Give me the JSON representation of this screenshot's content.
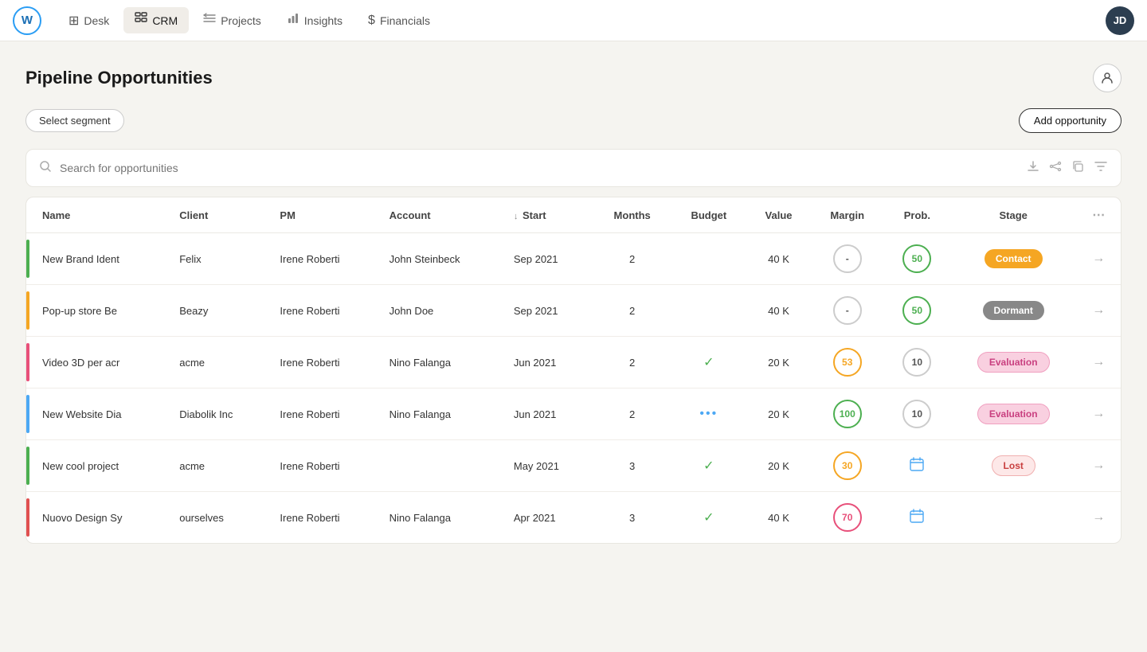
{
  "app": {
    "logo_initials": "W",
    "user_initials": "JD"
  },
  "nav": {
    "items": [
      {
        "id": "desk",
        "label": "Desk",
        "icon": "▦"
      },
      {
        "id": "crm",
        "label": "CRM",
        "icon": "▤",
        "active": true
      },
      {
        "id": "projects",
        "label": "Projects",
        "icon": "◫"
      },
      {
        "id": "insights",
        "label": "Insights",
        "icon": "▮"
      },
      {
        "id": "financials",
        "label": "Financials",
        "icon": "$"
      }
    ]
  },
  "page": {
    "title": "Pipeline Opportunities",
    "select_segment_label": "Select segment",
    "add_opportunity_label": "Add opportunity",
    "search_placeholder": "Search for opportunities"
  },
  "table": {
    "columns": [
      {
        "id": "name",
        "label": "Name"
      },
      {
        "id": "client",
        "label": "Client"
      },
      {
        "id": "pm",
        "label": "PM"
      },
      {
        "id": "account",
        "label": "Account"
      },
      {
        "id": "start",
        "label": "Start",
        "sortable": true
      },
      {
        "id": "months",
        "label": "Months"
      },
      {
        "id": "budget",
        "label": "Budget"
      },
      {
        "id": "value",
        "label": "Value"
      },
      {
        "id": "margin",
        "label": "Margin"
      },
      {
        "id": "prob",
        "label": "Prob."
      },
      {
        "id": "stage",
        "label": "Stage"
      }
    ],
    "rows": [
      {
        "id": 1,
        "indicator_color": "green",
        "name": "New Brand Ident",
        "client": "Felix",
        "pm": "Irene Roberti",
        "account": "John Steinbeck",
        "start": "Sep 2021",
        "months": "2",
        "budget": "",
        "budget_icon": "",
        "value": "40  K",
        "margin": "-",
        "margin_type": "plain",
        "prob": "50",
        "prob_type": "green",
        "stage": "Contact",
        "stage_type": "contact"
      },
      {
        "id": 2,
        "indicator_color": "orange",
        "name": "Pop-up store Be",
        "client": "Beazy",
        "pm": "Irene Roberti",
        "account": "John Doe",
        "start": "Sep 2021",
        "months": "2",
        "budget": "",
        "budget_icon": "",
        "value": "40  K",
        "margin": "-",
        "margin_type": "plain",
        "prob": "50",
        "prob_type": "green",
        "stage": "Dormant",
        "stage_type": "dormant"
      },
      {
        "id": 3,
        "indicator_color": "pink",
        "name": "Video 3D per acr",
        "client": "acme",
        "pm": "Irene Roberti",
        "account": "Nino Falanga",
        "start": "Jun 2021",
        "months": "2",
        "budget": "check",
        "budget_icon": "check",
        "value": "20  K",
        "margin": "53",
        "margin_type": "orange",
        "prob": "10",
        "prob_type": "plain",
        "stage": "Evaluation",
        "stage_type": "evaluation"
      },
      {
        "id": 4,
        "indicator_color": "blue",
        "name": "New Website Dia",
        "client": "Diabolik Inc",
        "pm": "Irene Roberti",
        "account": "Nino Falanga",
        "start": "Jun 2021",
        "months": "2",
        "budget": "dots",
        "budget_icon": "dots",
        "value": "20  K",
        "margin": "100",
        "margin_type": "full",
        "prob": "10",
        "prob_type": "plain",
        "stage": "Evaluation",
        "stage_type": "evaluation"
      },
      {
        "id": 5,
        "indicator_color": "green",
        "name": "New cool project",
        "client": "acme",
        "pm": "Irene Roberti",
        "account": "",
        "start": "May 2021",
        "months": "3",
        "budget": "check",
        "budget_icon": "check",
        "value": "20  K",
        "margin": "30",
        "margin_type": "orange",
        "prob": "calendar",
        "prob_type": "calendar",
        "stage": "Lost",
        "stage_type": "lost"
      },
      {
        "id": 6,
        "indicator_color": "red",
        "name": "Nuovo Design Sy",
        "client": "ourselves",
        "pm": "Irene Roberti",
        "account": "Nino Falanga",
        "start": "Apr 2021",
        "months": "3",
        "budget": "check",
        "budget_icon": "check",
        "value": "40  K",
        "margin": "70",
        "margin_type": "pink",
        "prob": "calendar",
        "prob_type": "calendar",
        "stage": "",
        "stage_type": ""
      }
    ]
  }
}
